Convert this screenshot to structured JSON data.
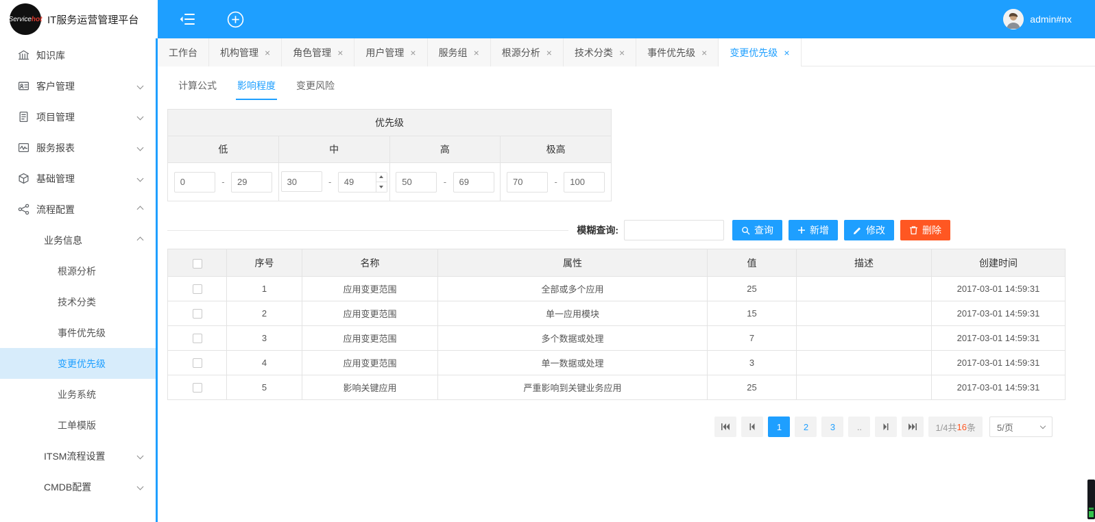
{
  "brand": {
    "logo_text_white": "Service",
    "logo_text_red": "hot",
    "app_title": "IT服务运营管理平台"
  },
  "topbar": {
    "username": "admin#nx"
  },
  "sidebar": {
    "items": [
      {
        "label": "知识库"
      },
      {
        "label": "客户管理"
      },
      {
        "label": "项目管理"
      },
      {
        "label": "服务报表"
      },
      {
        "label": "基础管理"
      },
      {
        "label": "流程配置"
      },
      {
        "label": "业务信息"
      },
      {
        "label": "根源分析"
      },
      {
        "label": "技术分类"
      },
      {
        "label": "事件优先级"
      },
      {
        "label": "变更优先级"
      },
      {
        "label": "业务系统"
      },
      {
        "label": "工单模版"
      },
      {
        "label": "ITSM流程设置"
      },
      {
        "label": "CMDB配置"
      }
    ]
  },
  "tab_close": "×",
  "tabs": [
    {
      "label": "工作台"
    },
    {
      "label": "机构管理"
    },
    {
      "label": "角色管理"
    },
    {
      "label": "用户管理"
    },
    {
      "label": "服务组"
    },
    {
      "label": "根源分析"
    },
    {
      "label": "技术分类"
    },
    {
      "label": "事件优先级"
    },
    {
      "label": "变更优先级"
    }
  ],
  "subtabs": [
    {
      "label": "计算公式"
    },
    {
      "label": "影响程度"
    },
    {
      "label": "变更风险"
    }
  ],
  "priority": {
    "title": "优先级",
    "range_separator": "-",
    "levels": [
      {
        "label": "低",
        "min": "0",
        "max": "29"
      },
      {
        "label": "中",
        "min": "30",
        "max": "49"
      },
      {
        "label": "高",
        "min": "50",
        "max": "69"
      },
      {
        "label": "极高",
        "min": "70",
        "max": "100"
      }
    ]
  },
  "toolbar": {
    "search_label": "模糊查询:",
    "search_value": "",
    "buttons": {
      "query": "查询",
      "add": "新增",
      "edit": "修改",
      "delete": "删除"
    }
  },
  "grid": {
    "columns": {
      "seq": "序号",
      "name": "名称",
      "attr": "属性",
      "value": "值",
      "desc": "描述",
      "created": "创建时间"
    },
    "rows": [
      {
        "seq": "1",
        "name": "应用变更范围",
        "attr": "全部或多个应用",
        "value": "25",
        "desc": "",
        "created": "2017-03-01 14:59:31"
      },
      {
        "seq": "2",
        "name": "应用变更范围",
        "attr": "单一应用模块",
        "value": "15",
        "desc": "",
        "created": "2017-03-01 14:59:31"
      },
      {
        "seq": "3",
        "name": "应用变更范围",
        "attr": "多个数据或处理",
        "value": "7",
        "desc": "",
        "created": "2017-03-01 14:59:31"
      },
      {
        "seq": "4",
        "name": "应用变更范围",
        "attr": "单一数据或处理",
        "value": "3",
        "desc": "",
        "created": "2017-03-01 14:59:31"
      },
      {
        "seq": "5",
        "name": "影响关键应用",
        "attr": "严重影响到关键业务应用",
        "value": "25",
        "desc": "",
        "created": "2017-03-01 14:59:31"
      }
    ]
  },
  "pagination": {
    "pages": {
      "p1": "1",
      "p2": "2",
      "p3": "3",
      "dots": ".."
    },
    "summary_prefix": "1/4共",
    "summary_count": "16",
    "summary_suffix": "条",
    "page_size": "5/页"
  },
  "colors": {
    "primary": "#1E9FFF",
    "danger": "#FF5722",
    "active_nav_bg": "#d7ecfb"
  }
}
